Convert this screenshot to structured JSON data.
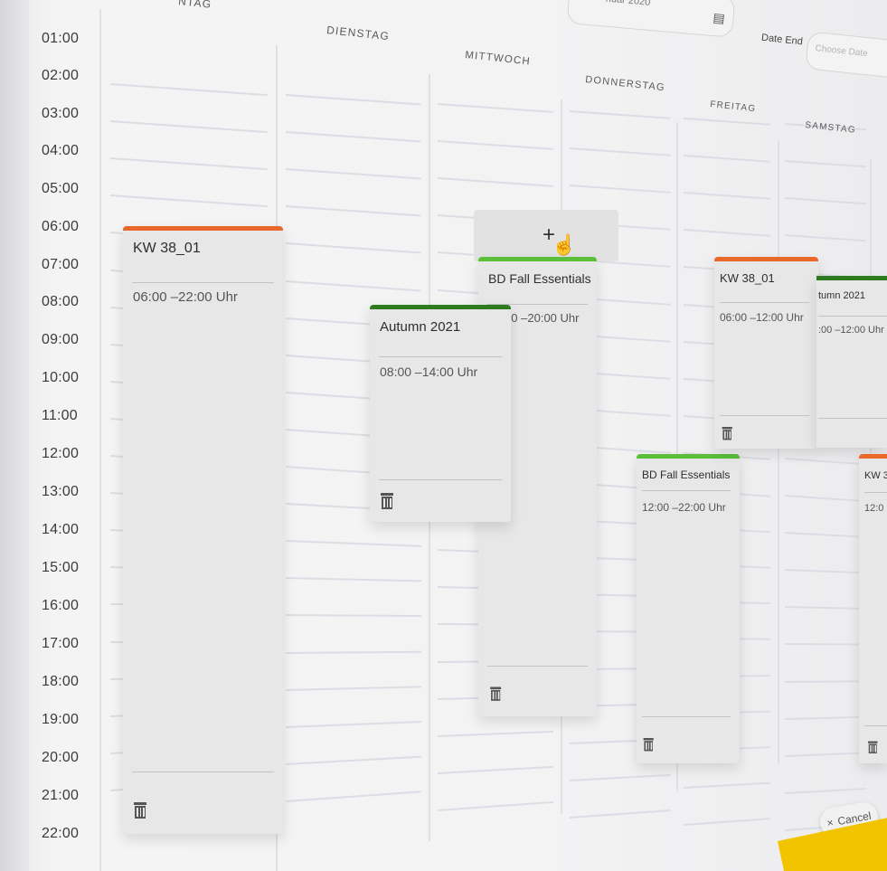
{
  "hours": [
    "01:00",
    "02:00",
    "03:00",
    "04:00",
    "05:00",
    "06:00",
    "07:00",
    "08:00",
    "09:00",
    "10:00",
    "11:00",
    "12:00",
    "13:00",
    "14:00",
    "15:00",
    "16:00",
    "17:00",
    "18:00",
    "19:00",
    "20:00",
    "21:00",
    "22:00"
  ],
  "days": {
    "monday_partial": "NTAG",
    "tuesday": "DIENSTAG",
    "wednesday": "MITTWOCH",
    "thursday": "DONNERSTAG",
    "friday": "FREITAG",
    "saturday": "SAMSTAG"
  },
  "header": {
    "date_start_value": "nuar 2020",
    "date_end_label": "Date End",
    "date_end_placeholder": "Choose Date"
  },
  "add_slot": {
    "plus": "+"
  },
  "events": [
    {
      "title": "KW 38_01",
      "time": "06:00 –22:00 Uhr",
      "color": "#e8692a"
    },
    {
      "title": "Autumn 2021",
      "time": "08:00 –14:00 Uhr",
      "color": "#2f7a1f"
    },
    {
      "title": "BD Fall Essentials",
      "time": "06:00 –20:00 Uhr",
      "color": "#5cbf3a"
    },
    {
      "title": "BD Fall Essentials",
      "time": "12:00 –22:00 Uhr",
      "color": "#5cbf3a"
    },
    {
      "title": "KW 38_01",
      "time": "06:00 –12:00 Uhr",
      "color": "#e8692a"
    },
    {
      "title": "tumn 2021",
      "time": ":00 –12:00 Uhr",
      "color": "#2f7a1f"
    },
    {
      "title": "KW 3",
      "time": "12:0",
      "color": "#e8692a"
    }
  ],
  "footer": {
    "cancel_label": "Cancel",
    "cancel_icon": "×"
  }
}
